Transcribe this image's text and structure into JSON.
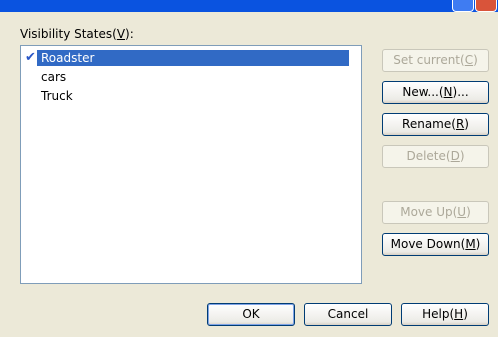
{
  "dialog": {
    "list_label": "Visibility States(",
    "list_label_mnemonic": "V",
    "list_label_end": "):"
  },
  "states": [
    {
      "name": "Roadster",
      "checked": true,
      "selected": true
    },
    {
      "name": "cars",
      "checked": false,
      "selected": false
    },
    {
      "name": "Truck",
      "checked": false,
      "selected": false
    }
  ],
  "check_glyph": "✔",
  "side_buttons": {
    "set_current": {
      "label": "Set current(",
      "mnemonic": "C",
      "end": ")",
      "enabled": false
    },
    "new": {
      "label": "New...(",
      "mnemonic": "N",
      "end": ")...",
      "enabled": true
    },
    "rename": {
      "label": "Rename(",
      "mnemonic": "R",
      "end": ")",
      "enabled": true
    },
    "delete": {
      "label": "Delete(",
      "mnemonic": "D",
      "end": ")",
      "enabled": false
    },
    "move_up": {
      "label": "Move Up(",
      "mnemonic": "U",
      "end": ")",
      "enabled": false
    },
    "move_down": {
      "label": "Move Down(",
      "mnemonic": "M",
      "end": ")",
      "enabled": true
    }
  },
  "footer_buttons": {
    "ok": "OK",
    "cancel": "Cancel",
    "help": {
      "label": "Help(",
      "mnemonic": "H",
      "end": ")"
    }
  },
  "colors": {
    "selection": "#316ac5",
    "check": "#2a57c7",
    "dialog_bg": "#ece9d8"
  }
}
